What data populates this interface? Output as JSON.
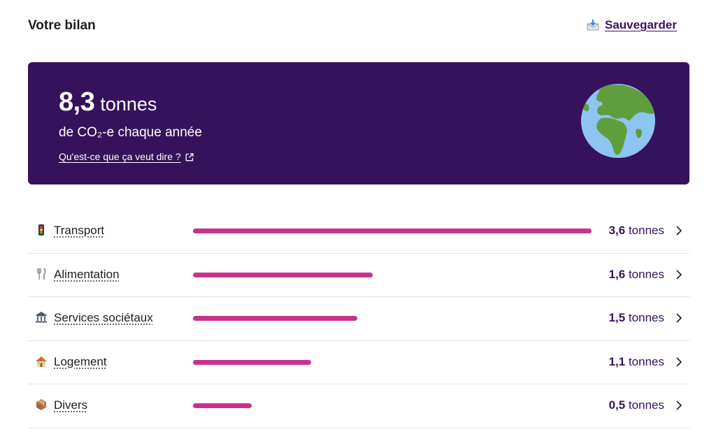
{
  "header": {
    "title": "Votre bilan",
    "save_label": "Sauvegarder",
    "save_icon": "envelope-download-icon"
  },
  "summary": {
    "total_value": "8,3",
    "total_unit": "tonnes",
    "subtitle": "de CO₂-e chaque année",
    "link_label": "Qu'est-ce que ça veut dire ?",
    "link_icon": "external-link-icon",
    "illustration": "earth-globe-icon",
    "colors": {
      "card_bg": "#36125c",
      "ocean": "#8ec4f2",
      "land": "#5f9e3c"
    }
  },
  "categories": [
    {
      "label": "Transport",
      "icon": "traffic-light-icon",
      "value": "3,6",
      "unit": "tonnes",
      "fraction": 1.0
    },
    {
      "label": "Alimentation",
      "icon": "fork-knife-icon",
      "value": "1,6",
      "unit": "tonnes",
      "fraction": 0.451
    },
    {
      "label": "Services sociétaux",
      "icon": "classical-building-icon",
      "value": "1,5",
      "unit": "tonnes",
      "fraction": 0.412
    },
    {
      "label": "Logement",
      "icon": "house-icon",
      "value": "1,1",
      "unit": "tonnes",
      "fraction": 0.296
    },
    {
      "label": "Divers",
      "icon": "package-icon",
      "value": "0,5",
      "unit": "tonnes",
      "fraction": 0.148
    }
  ],
  "bar_color": "#c8328d"
}
